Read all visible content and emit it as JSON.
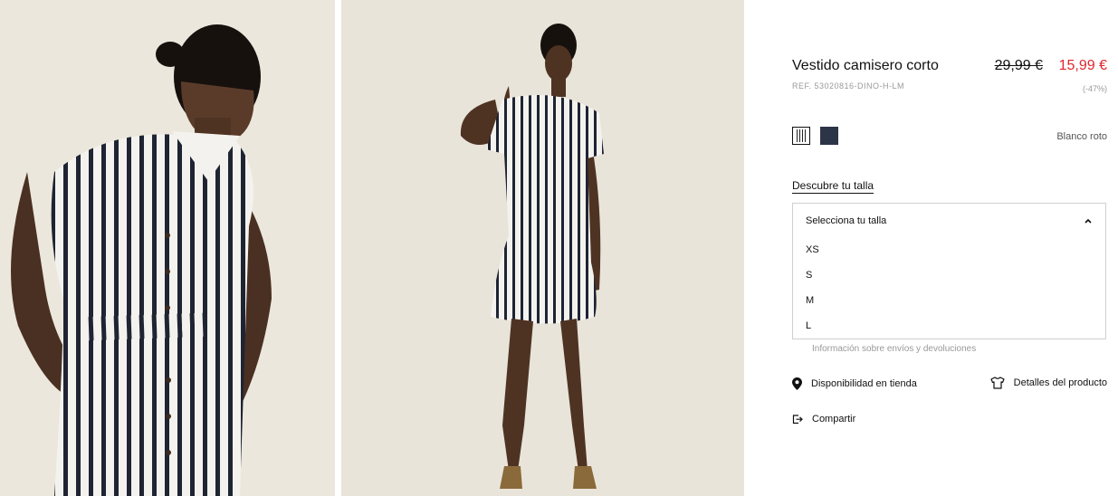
{
  "gallery": {
    "images": [
      {
        "alt": "Modelo con vestido de rayas, vista de detalle"
      },
      {
        "alt": "Modelo con vestido de rayas, cuerpo entero"
      }
    ]
  },
  "product": {
    "title": "Vestido camisero corto",
    "ref": "REF. 53020816-DINO-H-LM",
    "old_price": "29,99 €",
    "new_price": "15,99 €",
    "discount": "(-47%)",
    "price_color": "#e0262f"
  },
  "colors": {
    "selected_name": "Blanco roto",
    "swatches": [
      {
        "name": "stripes-swatch",
        "hex": "#ffffff"
      },
      {
        "name": "navy-swatch",
        "hex": "#2c3447"
      }
    ]
  },
  "size": {
    "guide_link": "Descubre tu talla",
    "select_label": "Selecciona tu talla",
    "options": [
      "XS",
      "S",
      "M",
      "L"
    ]
  },
  "shipping_info": "Información sobre envíos y devoluciones",
  "actions": {
    "store": "Disponibilidad en tienda",
    "details": "Detalles del producto",
    "share": "Compartir"
  },
  "icons": {
    "store": "location-pin-icon",
    "details": "tshirt-icon",
    "share": "share-icon",
    "dropdown": "chevron-up-icon"
  }
}
